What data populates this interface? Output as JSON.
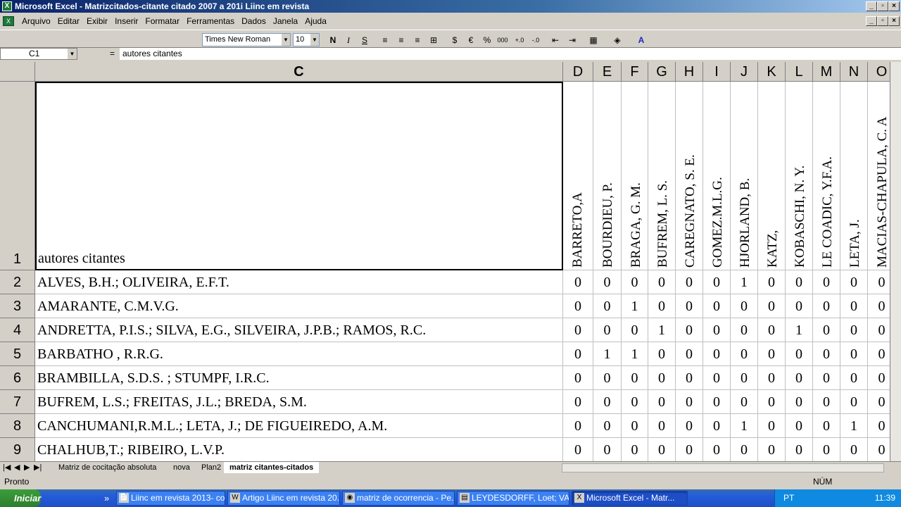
{
  "window": {
    "title": "Microsoft Excel - Matrizcitados-citante citado 2007 a 201i Liinc em revista"
  },
  "menu": [
    "Arquivo",
    "Editar",
    "Exibir",
    "Inserir",
    "Formatar",
    "Ferramentas",
    "Dados",
    "Janela",
    "Ajuda"
  ],
  "toolbar": {
    "font": "Times New Roman",
    "size": "10",
    "bold": "N",
    "italic": "I",
    "underline": "S",
    "currency": "€",
    "percent": "%",
    "thousands": "000"
  },
  "formula": {
    "cell_ref": "C1",
    "eq": "=",
    "value": "autores citantes"
  },
  "columns": [
    "C",
    "D",
    "E",
    "F",
    "G",
    "H",
    "I",
    "J",
    "K",
    "L",
    "M",
    "N",
    "O"
  ],
  "header_row": {
    "row": "1",
    "label": "autores citantes",
    "cited": [
      "BARRETO,A",
      "BOURDIEU, P.",
      "BRAGA, G. M.",
      "BUFREM, L. S.",
      "CAREGNATO, S. E.",
      "GOMEZ.M.L.G.",
      "HJORLAND, B.",
      "KATZ,",
      "KOBASCHI, N. Y.",
      "LE COADIC, Y.F.A.",
      "LETA, J.",
      "MACIAS-CHAPULA, C. A"
    ]
  },
  "rows": [
    {
      "num": "2",
      "name": "ALVES, B.H.; OLIVEIRA, E.F.T.",
      "values": [
        "0",
        "0",
        "0",
        "0",
        "0",
        "0",
        "1",
        "0",
        "0",
        "0",
        "0",
        "0"
      ]
    },
    {
      "num": "3",
      "name": "AMARANTE, C.M.V.G.",
      "values": [
        "0",
        "0",
        "1",
        "0",
        "0",
        "0",
        "0",
        "0",
        "0",
        "0",
        "0",
        "0"
      ]
    },
    {
      "num": "4",
      "name": "ANDRETTA, P.I.S.; SILVA, E.G., SILVEIRA, J.P.B.; RAMOS, R.C.",
      "values": [
        "0",
        "0",
        "0",
        "1",
        "0",
        "0",
        "0",
        "0",
        "1",
        "0",
        "0",
        "0"
      ]
    },
    {
      "num": "5",
      "name": "BARBATHO , R.R.G.",
      "values": [
        "0",
        "1",
        "1",
        "0",
        "0",
        "0",
        "0",
        "0",
        "0",
        "0",
        "0",
        "0"
      ]
    },
    {
      "num": "6",
      "name": "BRAMBILLA, S.D.S. ; STUMPF, I.R.C.",
      "values": [
        "0",
        "0",
        "0",
        "0",
        "0",
        "0",
        "0",
        "0",
        "0",
        "0",
        "0",
        "0"
      ]
    },
    {
      "num": "7",
      "name": "BUFREM, L.S.; FREITAS, J.L.; BREDA, S.M.",
      "values": [
        "0",
        "0",
        "0",
        "0",
        "0",
        "0",
        "0",
        "0",
        "0",
        "0",
        "0",
        "0"
      ]
    },
    {
      "num": "8",
      "name": "CANCHUMANI,R.M.L.; LETA, J.; DE  FIGUEIREDO, A.M.",
      "values": [
        "0",
        "0",
        "0",
        "0",
        "0",
        "0",
        "1",
        "0",
        "0",
        "0",
        "1",
        "0"
      ]
    },
    {
      "num": "9",
      "name": "CHALHUB,T.; RIBEIRO, L.V.P.",
      "values": [
        "0",
        "0",
        "0",
        "0",
        "0",
        "0",
        "0",
        "0",
        "0",
        "0",
        "0",
        "0"
      ]
    }
  ],
  "sheets": [
    "Matriz de cocitação absoluta",
    "nova",
    "Plan2",
    "matriz citantes-citados"
  ],
  "status": {
    "text": "Pronto",
    "num": "NÚM"
  },
  "taskbar": {
    "start": "Iniciar",
    "tasks": [
      "Liinc em revista 2013- co...",
      "Artigo Liinc em revista 20...",
      "matriz de ocorrencia - Pe...",
      "LEYDESDORFF, Loet; VA...",
      "Microsoft Excel - Matr..."
    ],
    "lang": "PT",
    "time": "11:39"
  }
}
